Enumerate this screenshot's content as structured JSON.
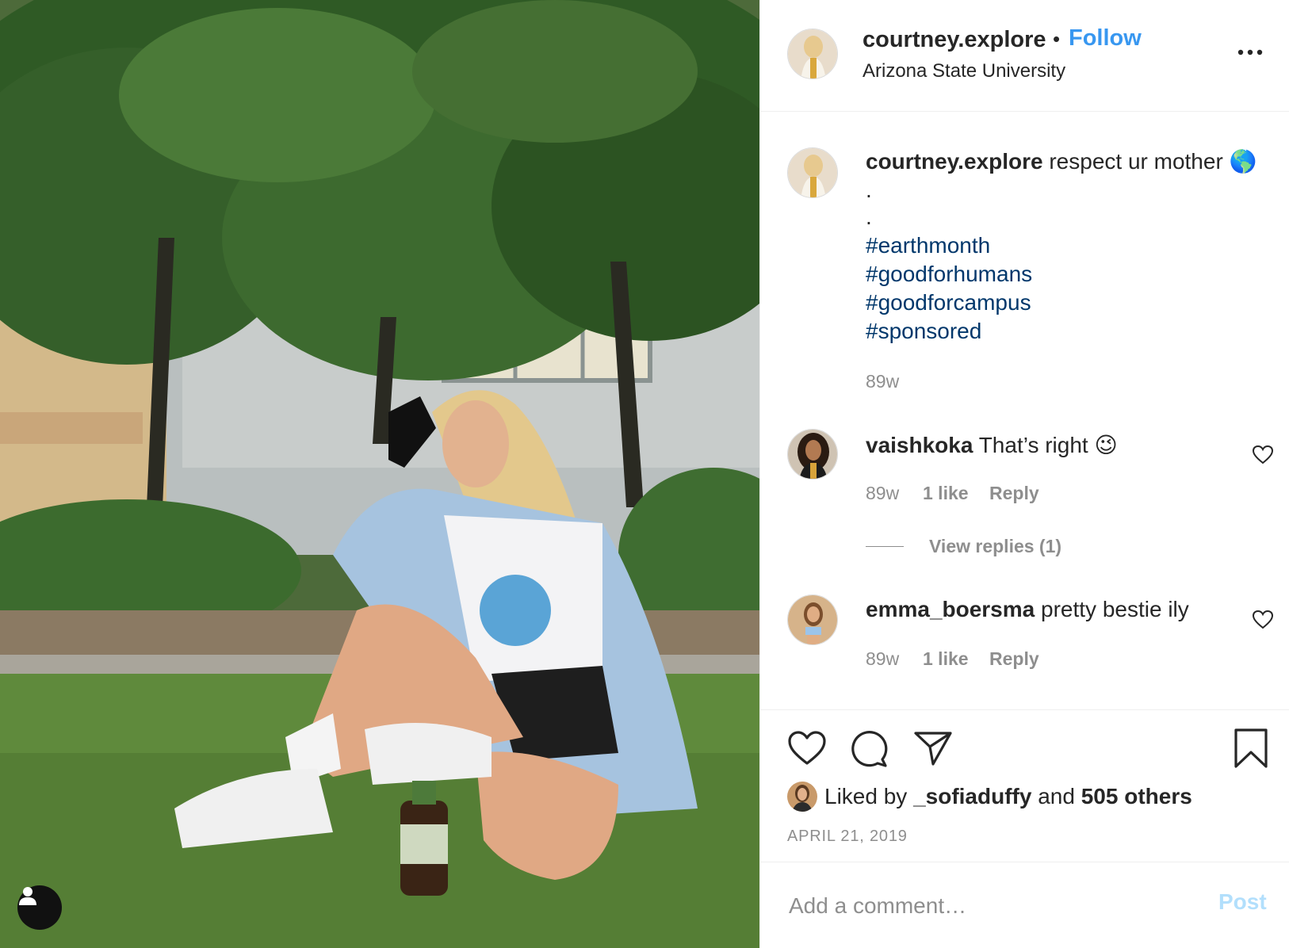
{
  "header": {
    "username": "courtney.explore",
    "separator": "•",
    "follow_label": "Follow",
    "location": "Arizona State University"
  },
  "caption": {
    "username": "courtney.explore",
    "text": "respect ur mother",
    "emoji": "🌎",
    "dot1": ".",
    "dot2": ".",
    "hashtags": [
      "#earthmonth",
      "#goodforhumans",
      "#goodforcampus",
      "#sponsored"
    ],
    "time": "89w"
  },
  "comments": [
    {
      "username": "vaishkoka",
      "text": "That’s right",
      "emoji": "😉",
      "time": "89w",
      "likes": "1 like",
      "reply_label": "Reply",
      "view_replies": "View replies (1)"
    },
    {
      "username": "emma_boersma",
      "text": "pretty bestie ily",
      "time": "89w",
      "likes": "1 like",
      "reply_label": "Reply"
    }
  ],
  "likes": {
    "prefix": "Liked by",
    "user": "_sofiaduffy",
    "and": "and",
    "others": "505 others"
  },
  "date": "APRIL 21, 2019",
  "add_comment": {
    "placeholder": "Add a comment…",
    "post_label": "Post"
  },
  "colors": {
    "follow_blue": "#3897f0",
    "hashtag_blue": "#00376b",
    "muted_gray": "#8e8e8e",
    "post_disabled": "#b2dffc"
  }
}
